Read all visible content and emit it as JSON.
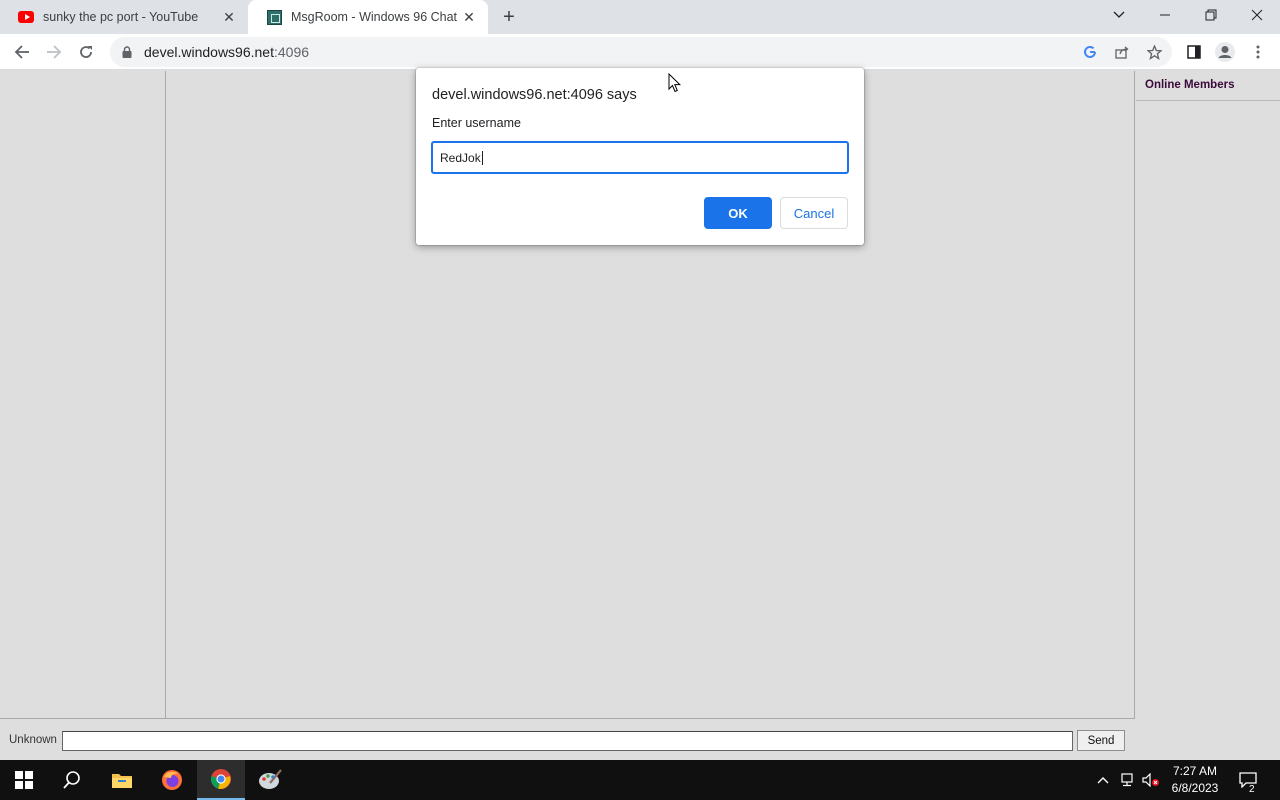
{
  "browser": {
    "tabs": [
      {
        "title": "sunky the pc port - YouTube",
        "icon": "youtube-icon",
        "active": false
      },
      {
        "title": "MsgRoom - Windows 96 Chat",
        "icon": "msgroom-icon",
        "active": true
      }
    ],
    "url_host": "devel.windows96.net",
    "url_port": ":4096"
  },
  "page": {
    "members_title": "Online Members",
    "nick_label": "Unknown",
    "message_value": "",
    "send_label": "Send"
  },
  "dialog": {
    "title": "devel.windows96.net:4096 says",
    "message": "Enter username",
    "input_value": "RedJok",
    "ok_label": "OK",
    "cancel_label": "Cancel"
  },
  "taskbar": {
    "time": "7:27 AM",
    "date": "6/8/2023",
    "notification_count": "2"
  },
  "colors": {
    "accent": "#1a73e8",
    "page_background": "#dedede",
    "members_title": "#3a0a3a"
  }
}
